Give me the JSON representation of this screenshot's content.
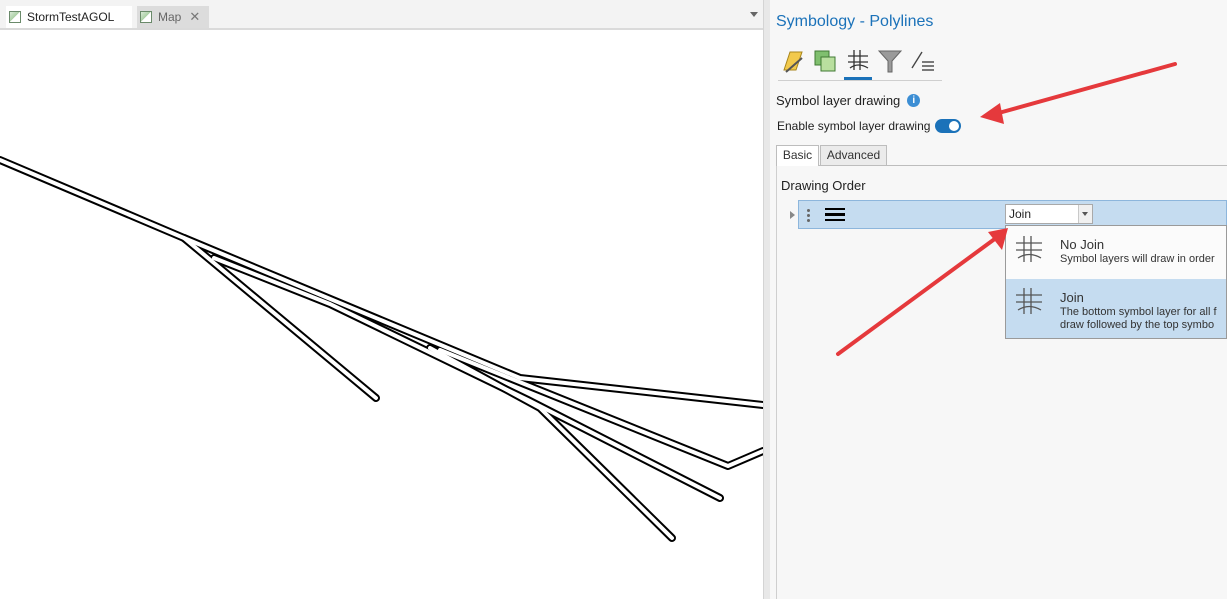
{
  "document_tabs": [
    {
      "label": "StormTestAGOL",
      "icon": "map-icon"
    },
    {
      "label": "Map",
      "icon": "map-icon",
      "close": "✕"
    }
  ],
  "pane": {
    "title": "Symbology - Polylines",
    "tool_tabs": [
      "primary-symbology-icon",
      "vary-symbology-icon",
      "symbol-layer-drawing-icon",
      "feature-filter-icon",
      "label-classes-icon"
    ],
    "section_title": "Symbol layer drawing",
    "enable_label": "Enable symbol layer drawing",
    "enable_on": true,
    "sub_tabs": [
      "Basic",
      "Advanced"
    ],
    "drawing_order_label": "Drawing Order",
    "join_combo_value": "Join",
    "join_options": [
      {
        "title": "No Join",
        "desc": "Symbol layers will draw in order"
      },
      {
        "title": "Join",
        "desc_line1": "The bottom symbol layer for all f",
        "desc_line2": "draw followed by the top symbo"
      }
    ]
  },
  "colors": {
    "accent": "#1b72b9",
    "selection": "#c5dcf0",
    "annotation_arrow": "#e5393c"
  }
}
